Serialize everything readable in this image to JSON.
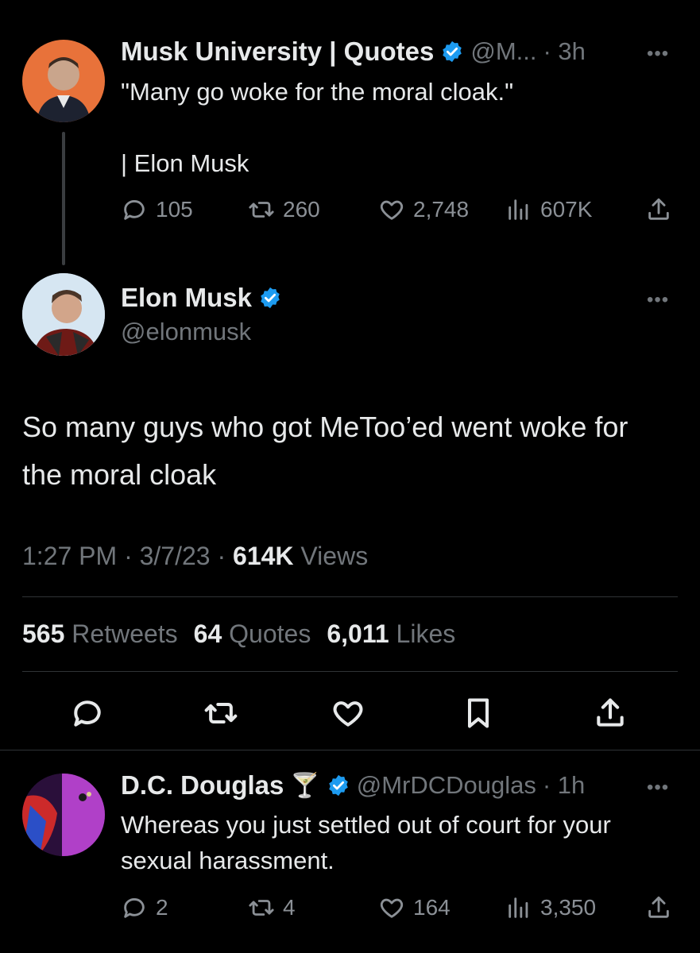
{
  "tweet1": {
    "name": "Musk University | Quotes",
    "handle": "@M...",
    "time": "· 3h",
    "line1": "\"Many go woke for the moral cloak.\"",
    "line2": "| Elon Musk",
    "replies": "105",
    "retweets": "260",
    "likes": "2,748",
    "views": "607K"
  },
  "main": {
    "name": "Elon Musk",
    "handle": "@elonmusk",
    "text": "So many guys who got MeToo’ed went woke for the moral cloak",
    "timestamp": "1:27 PM · 3/7/23 · ",
    "views_count": "614K",
    "views_label": " Views",
    "retweets_count": "565",
    "retweets_label": "Retweets",
    "quotes_count": "64",
    "quotes_label": "Quotes",
    "likes_count": "6,011",
    "likes_label": "Likes"
  },
  "reply": {
    "name": "D.C. Douglas",
    "emoji": "🍸",
    "handle": "@MrDCDouglas",
    "time": "· 1h",
    "text": "Whereas you just settled out of court for your sexual harassment.",
    "replies": "2",
    "retweets": "4",
    "likes": "164",
    "views": "3,350"
  },
  "colors": {
    "background": "#000000",
    "text": "#e7e9ea",
    "muted": "#71767b",
    "verified": "#1d9bf0",
    "divider": "#2f3336"
  }
}
